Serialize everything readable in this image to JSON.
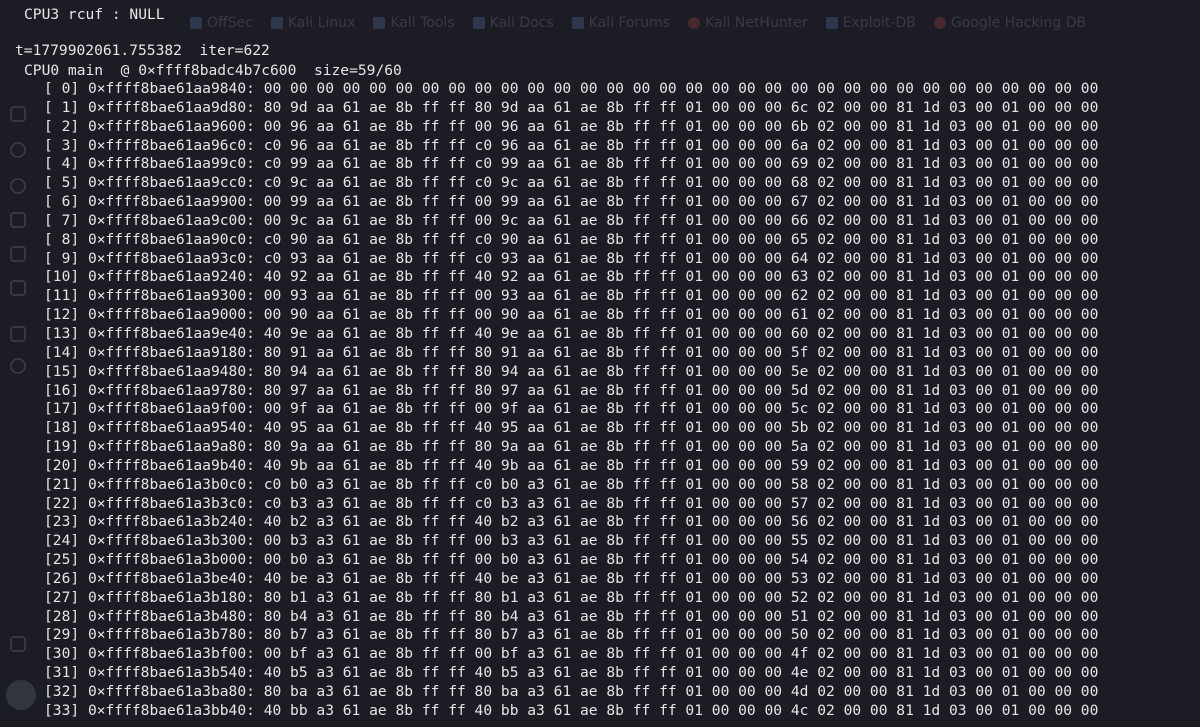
{
  "background_bookmarks": [
    {
      "label": "OffSec",
      "icon": "offsec-icon"
    },
    {
      "label": "Kali Linux",
      "icon": "kali-icon"
    },
    {
      "label": "Kali Tools",
      "icon": "kali-icon"
    },
    {
      "label": "Kali Docs",
      "icon": "kali-docs-icon"
    },
    {
      "label": "Kali Forums",
      "icon": "kali-icon"
    },
    {
      "label": "Kali NetHunter",
      "icon": "nethunter-icon"
    },
    {
      "label": "Exploit-DB",
      "icon": "exploitdb-icon"
    },
    {
      "label": "Google Hacking DB",
      "icon": "ghdb-icon"
    }
  ],
  "terminal": {
    "header": "CPU3 rcuf : NULL",
    "time_line": "t=1779902061.755382  iter=622",
    "cpu_line": "CPU0 main  @ 0×ffff8badc4b7c600  size=59/60",
    "rows": [
      {
        "index": "[ 0]",
        "address": "0×ffff8bae61aa9840:",
        "bytes": "00 00 00 00 00 00 00 00 00 00 00 00 00 00 00 00 00 00 00 00 00 00 00 00 00 00 00 00 00 00 00 00"
      },
      {
        "index": "[ 1]",
        "address": "0×ffff8bae61aa9d80:",
        "bytes": "80 9d aa 61 ae 8b ff ff 80 9d aa 61 ae 8b ff ff 01 00 00 00 6c 02 00 00 81 1d 03 00 01 00 00 00"
      },
      {
        "index": "[ 2]",
        "address": "0×ffff8bae61aa9600:",
        "bytes": "00 96 aa 61 ae 8b ff ff 00 96 aa 61 ae 8b ff ff 01 00 00 00 6b 02 00 00 81 1d 03 00 01 00 00 00"
      },
      {
        "index": "[ 3]",
        "address": "0×ffff8bae61aa96c0:",
        "bytes": "c0 96 aa 61 ae 8b ff ff c0 96 aa 61 ae 8b ff ff 01 00 00 00 6a 02 00 00 81 1d 03 00 01 00 00 00"
      },
      {
        "index": "[ 4]",
        "address": "0×ffff8bae61aa99c0:",
        "bytes": "c0 99 aa 61 ae 8b ff ff c0 99 aa 61 ae 8b ff ff 01 00 00 00 69 02 00 00 81 1d 03 00 01 00 00 00"
      },
      {
        "index": "[ 5]",
        "address": "0×ffff8bae61aa9cc0:",
        "bytes": "c0 9c aa 61 ae 8b ff ff c0 9c aa 61 ae 8b ff ff 01 00 00 00 68 02 00 00 81 1d 03 00 01 00 00 00"
      },
      {
        "index": "[ 6]",
        "address": "0×ffff8bae61aa9900:",
        "bytes": "00 99 aa 61 ae 8b ff ff 00 99 aa 61 ae 8b ff ff 01 00 00 00 67 02 00 00 81 1d 03 00 01 00 00 00"
      },
      {
        "index": "[ 7]",
        "address": "0×ffff8bae61aa9c00:",
        "bytes": "00 9c aa 61 ae 8b ff ff 00 9c aa 61 ae 8b ff ff 01 00 00 00 66 02 00 00 81 1d 03 00 01 00 00 00"
      },
      {
        "index": "[ 8]",
        "address": "0×ffff8bae61aa90c0:",
        "bytes": "c0 90 aa 61 ae 8b ff ff c0 90 aa 61 ae 8b ff ff 01 00 00 00 65 02 00 00 81 1d 03 00 01 00 00 00"
      },
      {
        "index": "[ 9]",
        "address": "0×ffff8bae61aa93c0:",
        "bytes": "c0 93 aa 61 ae 8b ff ff c0 93 aa 61 ae 8b ff ff 01 00 00 00 64 02 00 00 81 1d 03 00 01 00 00 00"
      },
      {
        "index": "[10]",
        "address": "0×ffff8bae61aa9240:",
        "bytes": "40 92 aa 61 ae 8b ff ff 40 92 aa 61 ae 8b ff ff 01 00 00 00 63 02 00 00 81 1d 03 00 01 00 00 00"
      },
      {
        "index": "[11]",
        "address": "0×ffff8bae61aa9300:",
        "bytes": "00 93 aa 61 ae 8b ff ff 00 93 aa 61 ae 8b ff ff 01 00 00 00 62 02 00 00 81 1d 03 00 01 00 00 00"
      },
      {
        "index": "[12]",
        "address": "0×ffff8bae61aa9000:",
        "bytes": "00 90 aa 61 ae 8b ff ff 00 90 aa 61 ae 8b ff ff 01 00 00 00 61 02 00 00 81 1d 03 00 01 00 00 00"
      },
      {
        "index": "[13]",
        "address": "0×ffff8bae61aa9e40:",
        "bytes": "40 9e aa 61 ae 8b ff ff 40 9e aa 61 ae 8b ff ff 01 00 00 00 60 02 00 00 81 1d 03 00 01 00 00 00"
      },
      {
        "index": "[14]",
        "address": "0×ffff8bae61aa9180:",
        "bytes": "80 91 aa 61 ae 8b ff ff 80 91 aa 61 ae 8b ff ff 01 00 00 00 5f 02 00 00 81 1d 03 00 01 00 00 00"
      },
      {
        "index": "[15]",
        "address": "0×ffff8bae61aa9480:",
        "bytes": "80 94 aa 61 ae 8b ff ff 80 94 aa 61 ae 8b ff ff 01 00 00 00 5e 02 00 00 81 1d 03 00 01 00 00 00"
      },
      {
        "index": "[16]",
        "address": "0×ffff8bae61aa9780:",
        "bytes": "80 97 aa 61 ae 8b ff ff 80 97 aa 61 ae 8b ff ff 01 00 00 00 5d 02 00 00 81 1d 03 00 01 00 00 00"
      },
      {
        "index": "[17]",
        "address": "0×ffff8bae61aa9f00:",
        "bytes": "00 9f aa 61 ae 8b ff ff 00 9f aa 61 ae 8b ff ff 01 00 00 00 5c 02 00 00 81 1d 03 00 01 00 00 00"
      },
      {
        "index": "[18]",
        "address": "0×ffff8bae61aa9540:",
        "bytes": "40 95 aa 61 ae 8b ff ff 40 95 aa 61 ae 8b ff ff 01 00 00 00 5b 02 00 00 81 1d 03 00 01 00 00 00"
      },
      {
        "index": "[19]",
        "address": "0×ffff8bae61aa9a80:",
        "bytes": "80 9a aa 61 ae 8b ff ff 80 9a aa 61 ae 8b ff ff 01 00 00 00 5a 02 00 00 81 1d 03 00 01 00 00 00"
      },
      {
        "index": "[20]",
        "address": "0×ffff8bae61aa9b40:",
        "bytes": "40 9b aa 61 ae 8b ff ff 40 9b aa 61 ae 8b ff ff 01 00 00 00 59 02 00 00 81 1d 03 00 01 00 00 00"
      },
      {
        "index": "[21]",
        "address": "0×ffff8bae61a3b0c0:",
        "bytes": "c0 b0 a3 61 ae 8b ff ff c0 b0 a3 61 ae 8b ff ff 01 00 00 00 58 02 00 00 81 1d 03 00 01 00 00 00"
      },
      {
        "index": "[22]",
        "address": "0×ffff8bae61a3b3c0:",
        "bytes": "c0 b3 a3 61 ae 8b ff ff c0 b3 a3 61 ae 8b ff ff 01 00 00 00 57 02 00 00 81 1d 03 00 01 00 00 00"
      },
      {
        "index": "[23]",
        "address": "0×ffff8bae61a3b240:",
        "bytes": "40 b2 a3 61 ae 8b ff ff 40 b2 a3 61 ae 8b ff ff 01 00 00 00 56 02 00 00 81 1d 03 00 01 00 00 00"
      },
      {
        "index": "[24]",
        "address": "0×ffff8bae61a3b300:",
        "bytes": "00 b3 a3 61 ae 8b ff ff 00 b3 a3 61 ae 8b ff ff 01 00 00 00 55 02 00 00 81 1d 03 00 01 00 00 00"
      },
      {
        "index": "[25]",
        "address": "0×ffff8bae61a3b000:",
        "bytes": "00 b0 a3 61 ae 8b ff ff 00 b0 a3 61 ae 8b ff ff 01 00 00 00 54 02 00 00 81 1d 03 00 01 00 00 00"
      },
      {
        "index": "[26]",
        "address": "0×ffff8bae61a3be40:",
        "bytes": "40 be a3 61 ae 8b ff ff 40 be a3 61 ae 8b ff ff 01 00 00 00 53 02 00 00 81 1d 03 00 01 00 00 00"
      },
      {
        "index": "[27]",
        "address": "0×ffff8bae61a3b180:",
        "bytes": "80 b1 a3 61 ae 8b ff ff 80 b1 a3 61 ae 8b ff ff 01 00 00 00 52 02 00 00 81 1d 03 00 01 00 00 00"
      },
      {
        "index": "[28]",
        "address": "0×ffff8bae61a3b480:",
        "bytes": "80 b4 a3 61 ae 8b ff ff 80 b4 a3 61 ae 8b ff ff 01 00 00 00 51 02 00 00 81 1d 03 00 01 00 00 00"
      },
      {
        "index": "[29]",
        "address": "0×ffff8bae61a3b780:",
        "bytes": "80 b7 a3 61 ae 8b ff ff 80 b7 a3 61 ae 8b ff ff 01 00 00 00 50 02 00 00 81 1d 03 00 01 00 00 00"
      },
      {
        "index": "[30]",
        "address": "0×ffff8bae61a3bf00:",
        "bytes": "00 bf a3 61 ae 8b ff ff 00 bf a3 61 ae 8b ff ff 01 00 00 00 4f 02 00 00 81 1d 03 00 01 00 00 00"
      },
      {
        "index": "[31]",
        "address": "0×ffff8bae61a3b540:",
        "bytes": "40 b5 a3 61 ae 8b ff ff 40 b5 a3 61 ae 8b ff ff 01 00 00 00 4e 02 00 00 81 1d 03 00 01 00 00 00"
      },
      {
        "index": "[32]",
        "address": "0×ffff8bae61a3ba80:",
        "bytes": "80 ba a3 61 ae 8b ff ff 80 ba a3 61 ae 8b ff ff 01 00 00 00 4d 02 00 00 81 1d 03 00 01 00 00 00"
      },
      {
        "index": "[33]",
        "address": "0×ffff8bae61a3bb40:",
        "bytes": "40 bb a3 61 ae 8b ff ff 40 bb a3 61 ae 8b ff ff 01 00 00 00 4c 02 00 00 81 1d 03 00 01 00 00 00"
      }
    ]
  },
  "colors": {
    "background": "#1c1c24",
    "text": "#e6e6e6"
  }
}
